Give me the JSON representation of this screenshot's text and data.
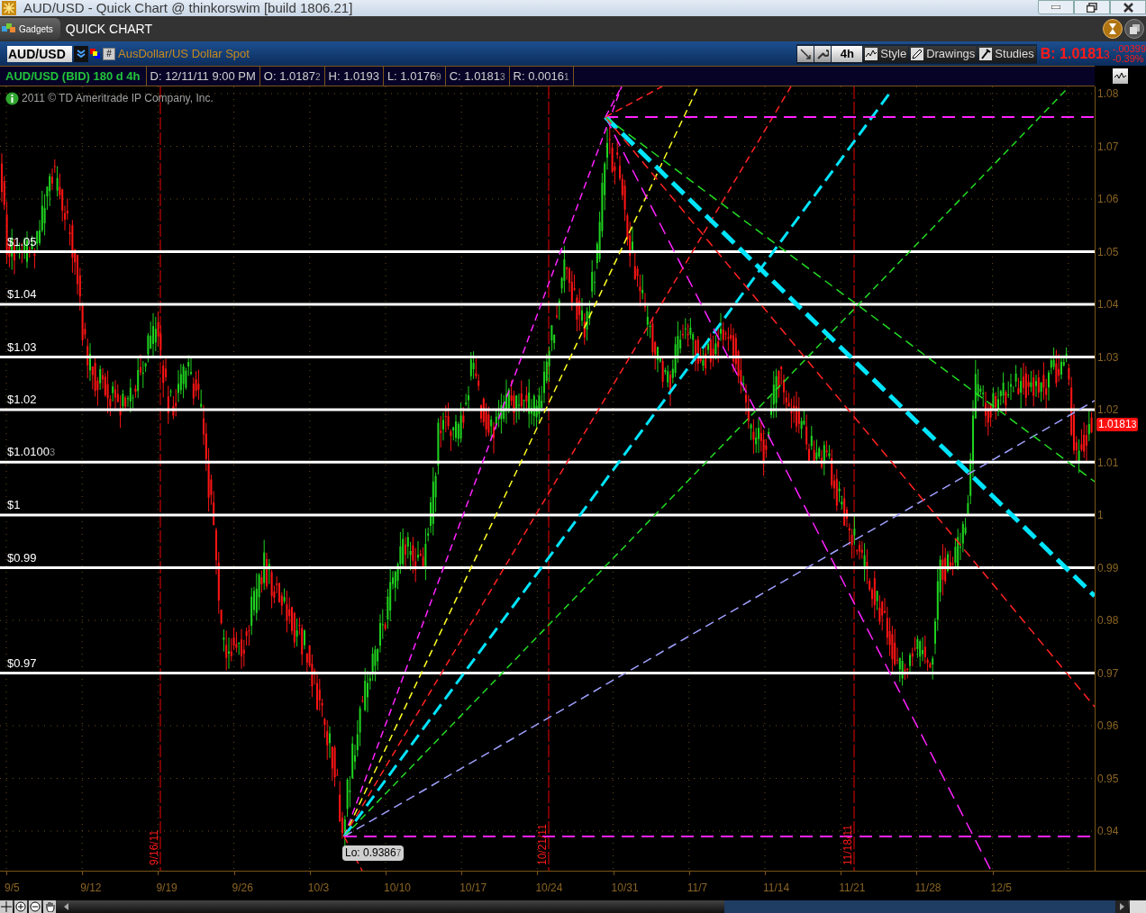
{
  "window": {
    "title": "AUD/USD - Quick Chart @ thinkorswim [build 1806.21]"
  },
  "gadgets_bar": {
    "gadgets_button": "Gadgets",
    "title": "QUICK CHART"
  },
  "symbol_bar": {
    "symbol": "AUD/USD",
    "hash_button": "#",
    "description": "AusDollar/US Dollar Spot",
    "aggregation": "4h",
    "buttons": [
      "Style",
      "Drawings",
      "Studies"
    ],
    "bid": {
      "label": "B:",
      "value": "1.0181",
      "pip": "3"
    },
    "change": "-.00399",
    "change_percent": "-0.39%"
  },
  "info_bar": {
    "title": "AUD/USD (BID) 180 d 4h",
    "fields": [
      {
        "text": "D: 12/11/11 9:00 PM"
      },
      {
        "text": "O: 1.0187",
        "pip": "2"
      },
      {
        "text": "H: 1.0193"
      },
      {
        "text": "L: 1.0176",
        "pip": "9"
      },
      {
        "text": "C: 1.0181",
        "pip": "3"
      },
      {
        "text": "R: 0.0016",
        "pip": "1"
      }
    ]
  },
  "copyright": "2011 © TD Ameritrade IP Company, Inc.",
  "price_axis": [
    "1.08",
    "1.07",
    "1.06",
    "1.05",
    "1.04",
    "1.03",
    "1.02",
    "1.01",
    "1",
    "0.99",
    "0.98",
    "0.97",
    "0.96",
    "0.95",
    "0.94"
  ],
  "price_lines": [
    {
      "label": "$1.05"
    },
    {
      "label": "$1.04"
    },
    {
      "label": "$1.03"
    },
    {
      "label": "$1.02"
    },
    {
      "label": "$1.0100",
      "pip": "3"
    },
    {
      "label": "$1"
    },
    {
      "label": "$0.99"
    },
    {
      "label": "$0.97"
    }
  ],
  "date_markers": [
    "9/16/11",
    "10/21/11",
    "11/18/11"
  ],
  "low_callout": {
    "label": "Lo: 0.9386",
    "pip": "7"
  },
  "last_price_tag": {
    "value": "1.0181",
    "pip": "3"
  },
  "date_axis": [
    "9/5",
    "9/12",
    "9/19",
    "9/26",
    "10/3",
    "10/10",
    "10/17",
    "10/24",
    "10/31",
    "11/7",
    "11/14",
    "11/21",
    "11/28",
    "12/5"
  ]
}
